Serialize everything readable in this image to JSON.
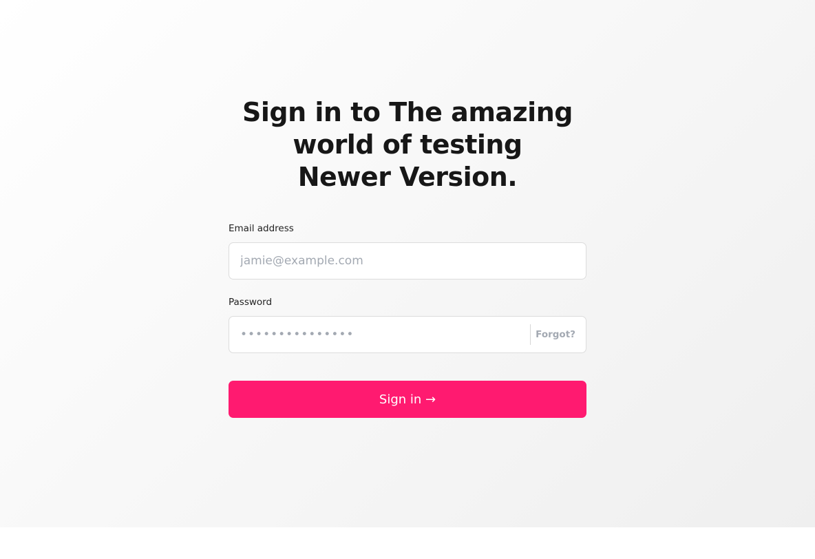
{
  "login": {
    "title": "Sign in to The amazing world of testing Newer Version.",
    "email": {
      "label": "Email address",
      "placeholder": "jamie@example.com",
      "value": ""
    },
    "password": {
      "label": "Password",
      "placeholder": "•••••••••••••••",
      "value": "",
      "forgot_label": "Forgot?"
    },
    "submit_label": "Sign in →"
  },
  "colors": {
    "accent": "#ff1a70",
    "heading": "#171717",
    "muted": "#a3a9b2",
    "border": "#dcdcdc"
  }
}
